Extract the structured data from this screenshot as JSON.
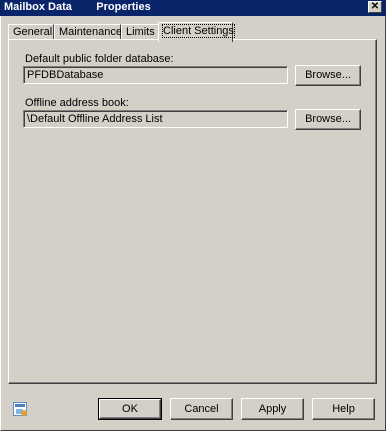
{
  "window": {
    "title": "Mailbox Data        Properties",
    "close_glyph": "✕"
  },
  "tabs": [
    {
      "label": "General"
    },
    {
      "label": "Maintenance"
    },
    {
      "label": "Limits"
    },
    {
      "label": "Client Settings",
      "active": true
    }
  ],
  "client_settings": {
    "public_folder_label": "Default public folder database:",
    "public_folder_value": "PFDBDatabase",
    "public_folder_browse": "Browse...",
    "oab_label": "Offline address book:",
    "oab_value": "\\Default Offline Address List",
    "oab_browse": "Browse..."
  },
  "footer": {
    "icon": "context-help-icon",
    "ok": "OK",
    "cancel": "Cancel",
    "apply": "Apply",
    "help": "Help"
  }
}
